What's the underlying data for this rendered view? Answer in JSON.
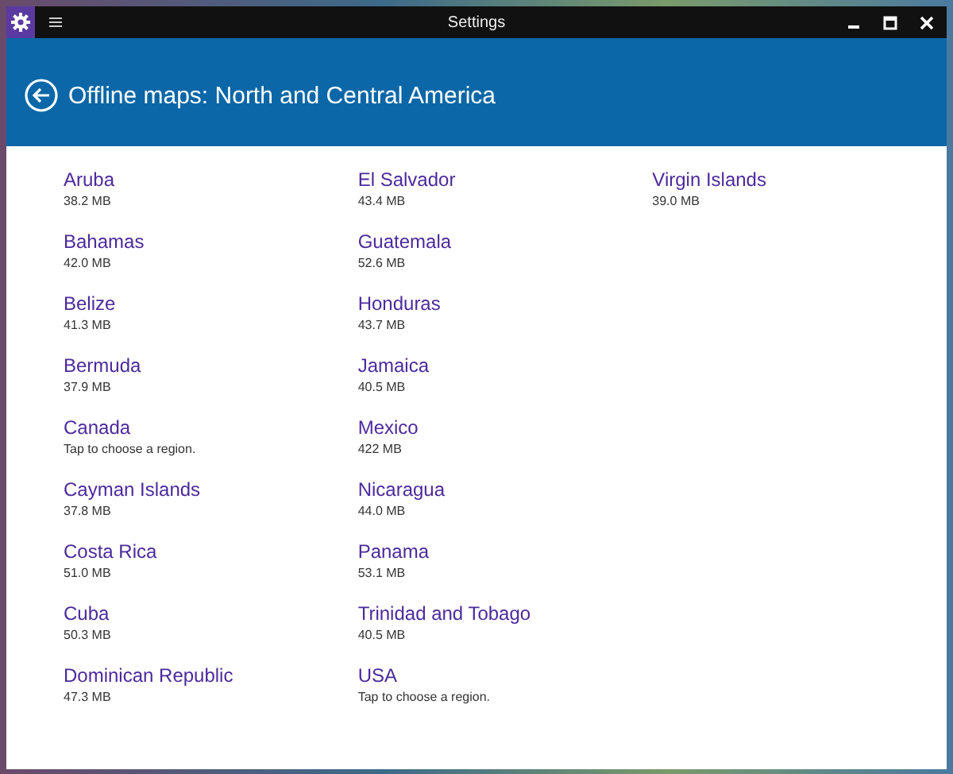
{
  "window": {
    "title": "Settings"
  },
  "header": {
    "title": "Offline maps: North and Central America"
  },
  "columns": [
    [
      {
        "name": "Aruba",
        "detail": "38.2 MB"
      },
      {
        "name": "Bahamas",
        "detail": "42.0 MB"
      },
      {
        "name": "Belize",
        "detail": "41.3 MB"
      },
      {
        "name": "Bermuda",
        "detail": "37.9 MB"
      },
      {
        "name": "Canada",
        "detail": "Tap to choose a region."
      },
      {
        "name": "Cayman Islands",
        "detail": "37.8 MB"
      },
      {
        "name": "Costa Rica",
        "detail": "51.0 MB"
      },
      {
        "name": "Cuba",
        "detail": "50.3 MB"
      },
      {
        "name": "Dominican Republic",
        "detail": "47.3 MB"
      }
    ],
    [
      {
        "name": "El Salvador",
        "detail": "43.4 MB"
      },
      {
        "name": "Guatemala",
        "detail": "52.6 MB"
      },
      {
        "name": "Honduras",
        "detail": "43.7 MB"
      },
      {
        "name": "Jamaica",
        "detail": "40.5 MB"
      },
      {
        "name": "Mexico",
        "detail": "422 MB"
      },
      {
        "name": "Nicaragua",
        "detail": "44.0 MB"
      },
      {
        "name": "Panama",
        "detail": "53.1 MB"
      },
      {
        "name": "Trinidad and Tobago",
        "detail": "40.5 MB"
      },
      {
        "name": "USA",
        "detail": "Tap to choose a region."
      }
    ],
    [
      {
        "name": "Virgin Islands",
        "detail": "39.0 MB"
      }
    ]
  ]
}
